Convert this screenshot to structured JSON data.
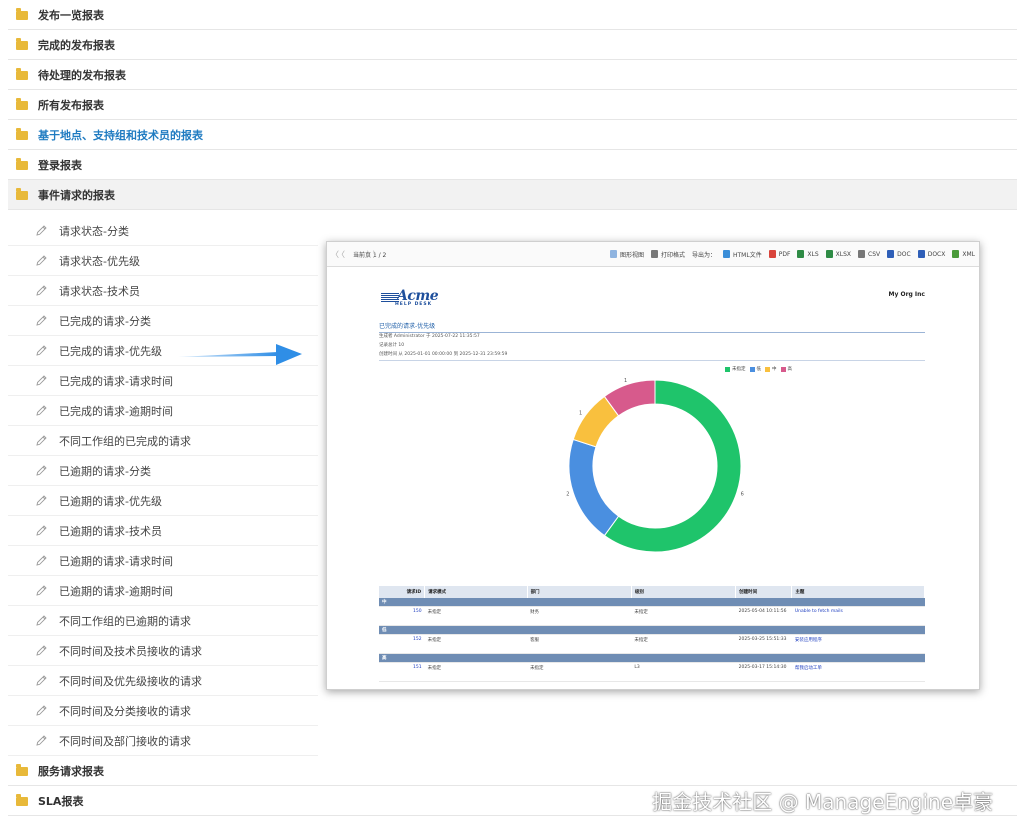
{
  "folders_top": [
    {
      "label": "发布一览报表",
      "style": "normal"
    },
    {
      "label": "完成的发布报表",
      "style": "normal"
    },
    {
      "label": "待处理的发布报表",
      "style": "normal"
    },
    {
      "label": "所有发布报表",
      "style": "normal"
    },
    {
      "label": "基于地点、支持组和技术员的报表",
      "style": "link"
    },
    {
      "label": "登录报表",
      "style": "normal"
    },
    {
      "label": "事件请求的报表",
      "style": "open"
    }
  ],
  "reports": [
    "请求状态-分类",
    "请求状态-优先级",
    "请求状态-技术员",
    "已完成的请求-分类",
    "已完成的请求-优先级",
    "已完成的请求-请求时间",
    "已完成的请求-逾期时间",
    "不同工作组的已完成的请求",
    "已逾期的请求-分类",
    "已逾期的请求-优先级",
    "已逾期的请求-技术员",
    "已逾期的请求-请求时间",
    "已逾期的请求-逾期时间",
    "不同工作组的已逾期的请求",
    "不同时间及技术员接收的请求",
    "不同时间及优先级接收的请求",
    "不同时间及分类接收的请求",
    "不同时间及部门接收的请求"
  ],
  "folders_bottom": [
    {
      "label": "服务请求报表"
    },
    {
      "label": "SLA报表"
    }
  ],
  "preview": {
    "toolbar": {
      "page_info": "当前页 1 / 2",
      "chart_view": "图形视图",
      "print_view": "打印格式",
      "export_label": "导出为：",
      "formats": [
        "HTML文件",
        "PDF",
        "XLS",
        "XLSX",
        "CSV",
        "DOC",
        "DOCX",
        "XML"
      ]
    },
    "logo": {
      "main": "Acme",
      "sub": "HELP DESK"
    },
    "org_name": "My Org Inc",
    "report_title": "已完成的请求-优先级",
    "meta": [
      "生成者 Administrator 于 2025-07-22 11:35:57",
      "记录总计 10",
      "创建时间 从 2025-01-01 00:00:00 到 2025-12-31 23:59:59"
    ],
    "colors": {
      "green": "#1fc46b",
      "blue": "#4a8fe0",
      "yellow": "#f9c03e",
      "pink": "#d75a8c"
    },
    "table": {
      "headers": [
        "请求ID",
        "请求模式",
        "部门",
        "级别",
        "创建时间",
        "主题"
      ],
      "groups": [
        {
          "name": "中",
          "rows": [
            [
              "150",
              "未指定",
              "财务",
              "未指定",
              "2025-05-04 10:11:56",
              "Unable to fetch mails"
            ]
          ]
        },
        {
          "name": "低",
          "rows": [
            [
              "152",
              "未指定",
              "客服",
              "未指定",
              "2025-03-25 15:51:33",
              "安装应用程序"
            ]
          ]
        },
        {
          "name": "高",
          "rows": [
            [
              "151",
              "未指定",
              "未指定",
              "L3",
              "2025-03-17 15:14:30",
              "帮我启动工单"
            ]
          ]
        }
      ]
    }
  },
  "chart_data": {
    "type": "pie",
    "variant": "donut",
    "categories": [
      "未指定",
      "低",
      "中",
      "高"
    ],
    "values": [
      6,
      2,
      1,
      1
    ],
    "colors": [
      "#1fc46b",
      "#4a8fe0",
      "#f9c03e",
      "#d75a8c"
    ],
    "legend": "top-right"
  },
  "watermark": "掘金技术社区 @ ManageEngine卓豪"
}
